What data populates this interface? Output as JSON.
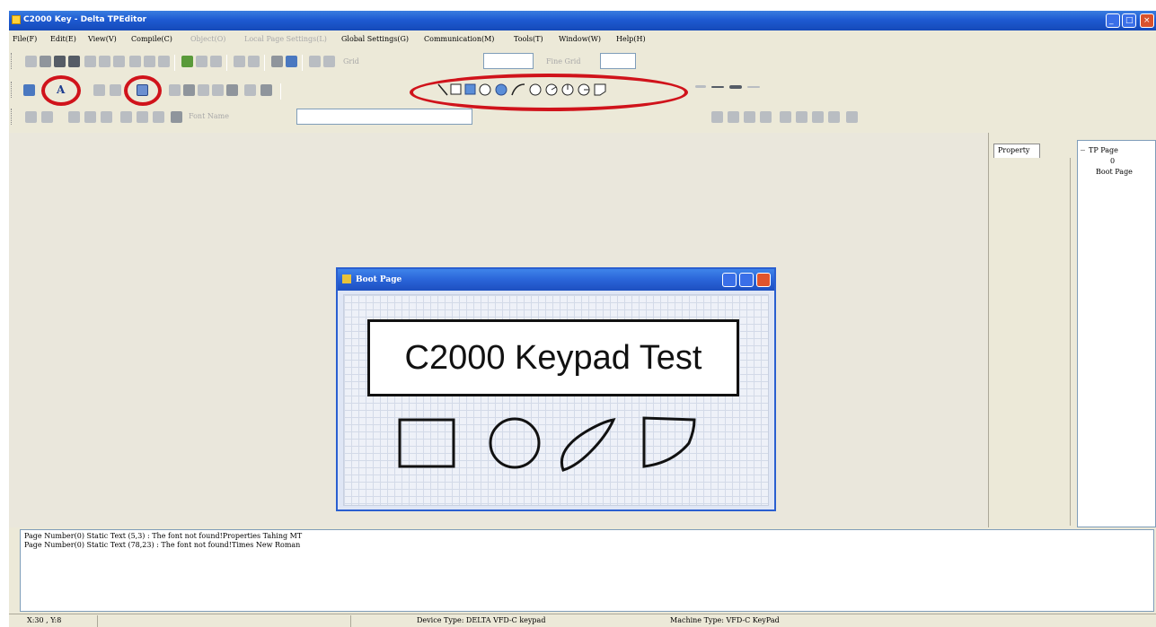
{
  "window": {
    "title": "C2000 Key - Delta TPEditor"
  },
  "menu": {
    "items": [
      {
        "label": "File(F)",
        "enabled": true
      },
      {
        "label": "Edit(E)",
        "enabled": true
      },
      {
        "label": "View(V)",
        "enabled": true
      },
      {
        "label": "Compile(C)",
        "enabled": true
      },
      {
        "label": "Object(O)",
        "enabled": false
      },
      {
        "label": "Local Page Settings(L)",
        "enabled": false
      },
      {
        "label": "Global Settings(G)",
        "enabled": true
      },
      {
        "label": "Communication(M)",
        "enabled": true
      },
      {
        "label": "Tools(T)",
        "enabled": true
      },
      {
        "label": "Window(W)",
        "enabled": true
      },
      {
        "label": "Help(H)",
        "enabled": true
      }
    ]
  },
  "toolbar": {
    "text_tool_glyph": "A",
    "line_tool_glyph": "\\",
    "arc_tool_glyph": "(",
    "grid_label": "Grid",
    "fine_label": "Fine Grid",
    "font_name_placeholder": "Font Name",
    "highlight_color": "#d0131b"
  },
  "child_window": {
    "title": "Boot Page",
    "textbox_text": "C2000 Keypad Test"
  },
  "property_panel": {
    "tab_label": "Property"
  },
  "tree": {
    "root": "TP Page",
    "node_index": "0",
    "node_label": "Boot Page"
  },
  "output": {
    "lines": [
      "Page Number(0) Static Text (5,3) : The font not found!Properties Tahing MT",
      "Page Number(0) Static Text (78,23) : The font not found!Times New Roman"
    ]
  },
  "status": {
    "coords": "X:30 , Y:8",
    "device_type": "Device Type: DELTA VFD-C keypad",
    "machine_type": "Machine Type: VFD-C KeyPad"
  }
}
